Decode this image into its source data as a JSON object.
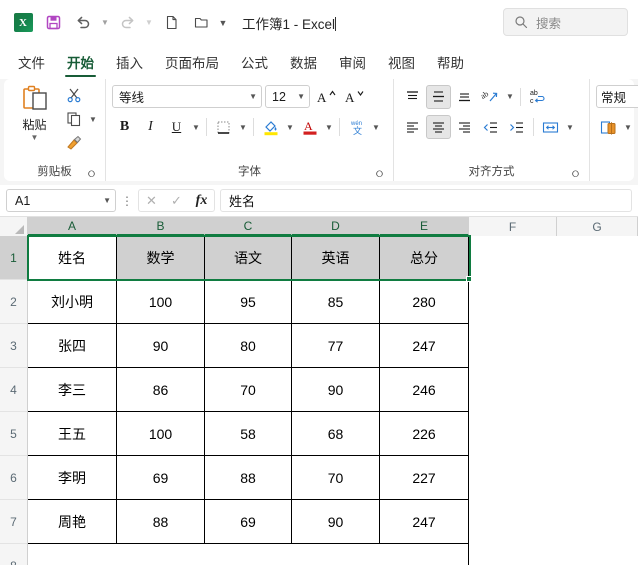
{
  "titlebar": {
    "app_icon": "excel-logo",
    "quick_access": [
      {
        "name": "save",
        "icon": "save-icon"
      },
      {
        "name": "undo",
        "icon": "undo-icon",
        "caret": true
      },
      {
        "name": "redo",
        "icon": "redo-icon",
        "caret": true
      },
      {
        "name": "new",
        "icon": "new-file-icon"
      },
      {
        "name": "open",
        "icon": "open-folder-icon"
      },
      {
        "name": "customize",
        "icon": "chevron-down-icon"
      }
    ],
    "document_title": "工作簿1",
    "separator": "-",
    "app_name": "Excel",
    "search_placeholder": "搜索",
    "search_icon": "search-icon"
  },
  "tabs": [
    {
      "label": "文件",
      "active": false
    },
    {
      "label": "开始",
      "active": true
    },
    {
      "label": "插入",
      "active": false
    },
    {
      "label": "页面布局",
      "active": false
    },
    {
      "label": "公式",
      "active": false
    },
    {
      "label": "数据",
      "active": false
    },
    {
      "label": "审阅",
      "active": false
    },
    {
      "label": "视图",
      "active": false
    },
    {
      "label": "帮助",
      "active": false
    }
  ],
  "ribbon": {
    "clipboard": {
      "group_label": "剪贴板",
      "paste_label": "粘贴",
      "paste_icon": "paste-clipboard-icon",
      "cut_icon": "scissors-icon",
      "copy_icon": "copy-icon",
      "format_painter_icon": "format-painter-icon"
    },
    "font": {
      "group_label": "字体",
      "font_name": "等线",
      "font_size": "12",
      "grow_font_icon": "grow-font-icon",
      "shrink_font_icon": "shrink-font-icon",
      "bold_label": "B",
      "italic_label": "I",
      "underline_label": "U",
      "borders_icon": "borders-icon",
      "fill_color_icon": "fill-color-icon",
      "font_color_icon": "font-color-icon",
      "phonetic_icon": "phonetic-guide-icon"
    },
    "alignment": {
      "group_label": "对齐方式",
      "align_top_icon": "align-top-icon",
      "align_middle_icon": "align-middle-icon",
      "align_bottom_icon": "align-bottom-icon",
      "orientation_icon": "text-orientation-icon",
      "wrap_text_icon": "wrap-text-icon",
      "align_left_icon": "align-left-icon",
      "align_center_icon": "align-center-icon",
      "align_right_icon": "align-right-icon",
      "decrease_indent_icon": "decrease-indent-icon",
      "increase_indent_icon": "increase-indent-icon",
      "merge_center_icon": "merge-and-center-icon"
    },
    "number": {
      "format_value": "常规",
      "accounting_icon": "accounting-format-icon"
    }
  },
  "formula_bar": {
    "name_box_value": "A1",
    "cancel_icon": "cancel-x-icon",
    "enter_icon": "enter-check-icon",
    "function_icon": "insert-function-fx-icon",
    "formula_value": "姓名"
  },
  "grid": {
    "column_headers": [
      "A",
      "B",
      "C",
      "D",
      "E",
      "F",
      "G"
    ],
    "row_headers": [
      "1",
      "2",
      "3",
      "4",
      "5",
      "6",
      "7",
      "8"
    ],
    "selected_range": "A1:E1",
    "active_cell": "A1",
    "selection_color": "#107c41",
    "header_fill_color": "#d0d0d0",
    "table_headers": [
      "姓名",
      "数学",
      "语文",
      "英语",
      "总分"
    ],
    "rows": [
      [
        "刘小明",
        "100",
        "95",
        "85",
        "280"
      ],
      [
        "张四",
        "90",
        "80",
        "77",
        "247"
      ],
      [
        "李三",
        "86",
        "70",
        "90",
        "246"
      ],
      [
        "王五",
        "100",
        "58",
        "68",
        "226"
      ],
      [
        "李明",
        "69",
        "88",
        "70",
        "227"
      ],
      [
        "周艳",
        "88",
        "69",
        "90",
        "247"
      ]
    ]
  }
}
